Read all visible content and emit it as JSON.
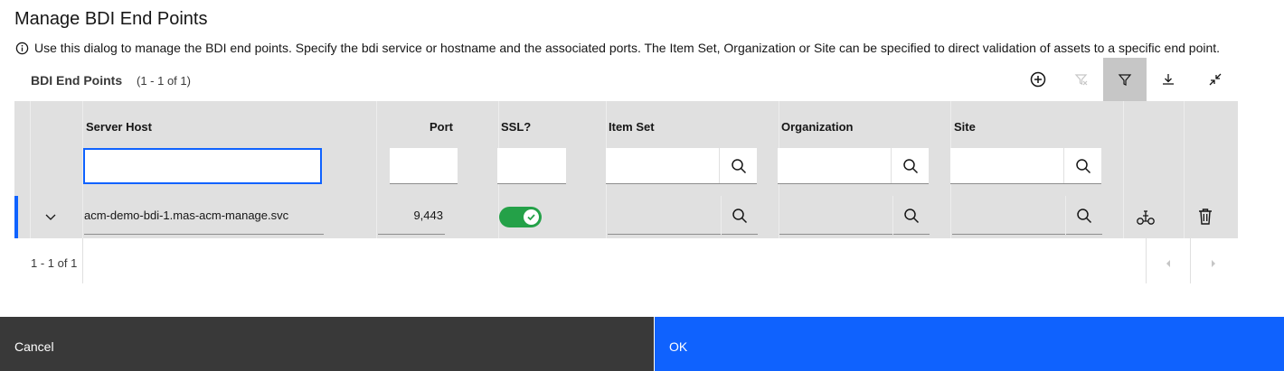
{
  "dialog": {
    "title": "Manage BDI End Points",
    "info_text": "Use this dialog to manage the BDI end points. Specify the bdi service or hostname and the associated ports. The Item Set, Organization or Site can be specified to direct validation of assets to a specific end point."
  },
  "table": {
    "title": "BDI End Points",
    "count": "(1 - 1 of 1)",
    "toolbar": {
      "add_icon": "add-circle-icon",
      "clear_filter_icon": "filter-remove-icon",
      "filter_icon": "filter-icon",
      "download_icon": "download-icon",
      "collapse_icon": "minimize-icon"
    },
    "columns": [
      {
        "key": "server_host",
        "label": "Server Host"
      },
      {
        "key": "port",
        "label": "Port"
      },
      {
        "key": "ssl",
        "label": "SSL?"
      },
      {
        "key": "item_set",
        "label": "Item Set"
      },
      {
        "key": "organization",
        "label": "Organization"
      },
      {
        "key": "site",
        "label": "Site"
      }
    ],
    "filters": {
      "server_host": "",
      "port": "",
      "ssl": "",
      "item_set": "",
      "organization": "",
      "site": ""
    },
    "rows": [
      {
        "server_host": "acm-demo-bdi-1.mas-acm-manage.svc",
        "port": "9,443",
        "ssl": true,
        "item_set": "",
        "organization": "",
        "site": ""
      }
    ],
    "pagination": {
      "label": "1 - 1 of 1"
    }
  },
  "footer": {
    "cancel_label": "Cancel",
    "ok_label": "OK"
  },
  "colors": {
    "primary": "#0f62fe",
    "secondary": "#393939",
    "toggle_on": "#24a148",
    "grid_bg": "#e0e0e0"
  }
}
